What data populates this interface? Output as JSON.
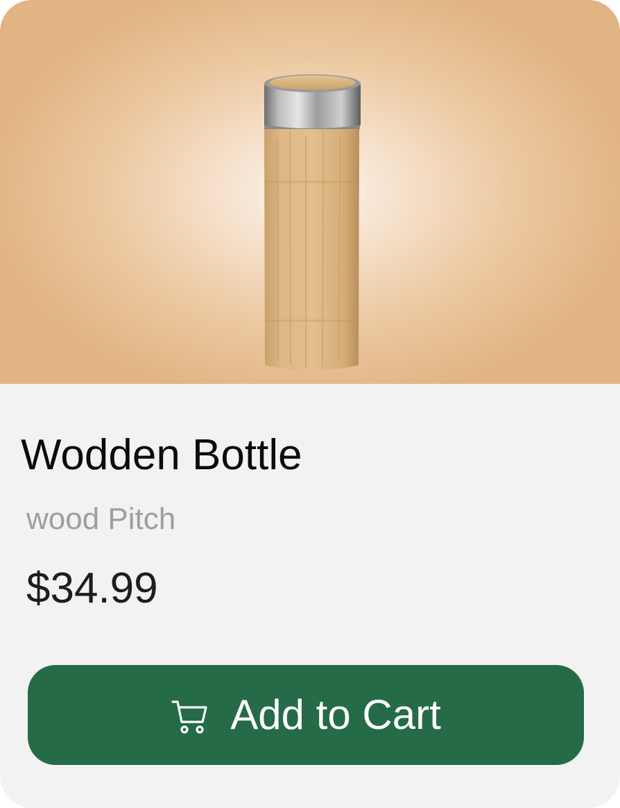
{
  "product": {
    "name": "Wodden Bottle",
    "material": "wood Pitch",
    "price": "$34.99"
  },
  "actions": {
    "add_to_cart_label": "Add to Cart",
    "add_to_cart_icon": "cart-icon"
  },
  "colors": {
    "button_background": "#256b47",
    "card_background": "#f2f2f2",
    "hero_outer": "#e1b483",
    "hero_center": "#fdf4ec",
    "subtitle": "#9e9e9e"
  }
}
